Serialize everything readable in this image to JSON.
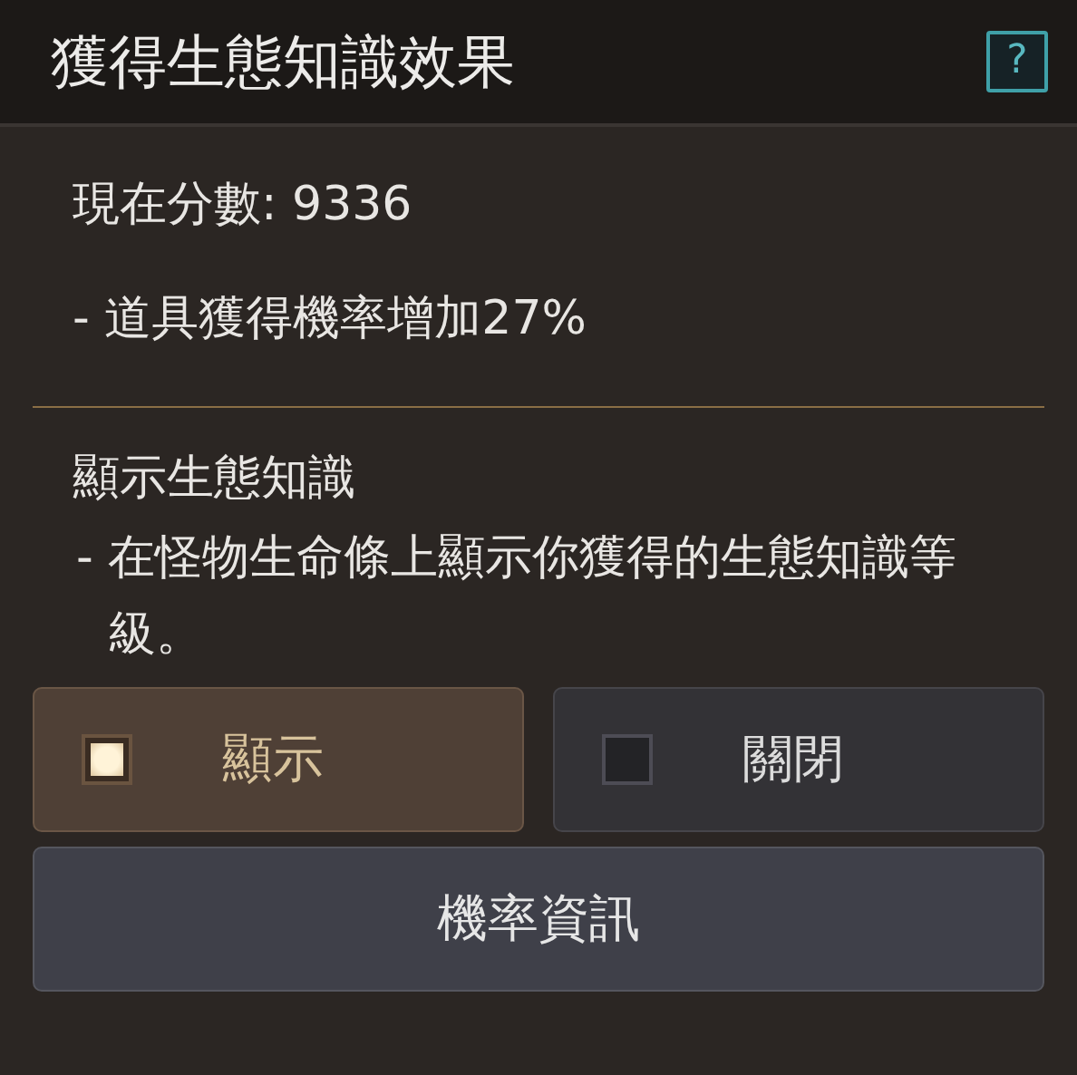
{
  "window": {
    "title": "獲得生態知識效果",
    "help": "?"
  },
  "score": {
    "label": "現在分數: 9336"
  },
  "effects": [
    "- 道具獲得機率增加27%"
  ],
  "display_section": {
    "title": "顯示生態知識",
    "description": "- 在怪物生命條上顯示你獲得的生態知識等級。"
  },
  "options": [
    {
      "label": "顯示",
      "selected": true
    },
    {
      "label": "關閉",
      "selected": false
    }
  ],
  "info_button": {
    "label": "機率資訊"
  }
}
